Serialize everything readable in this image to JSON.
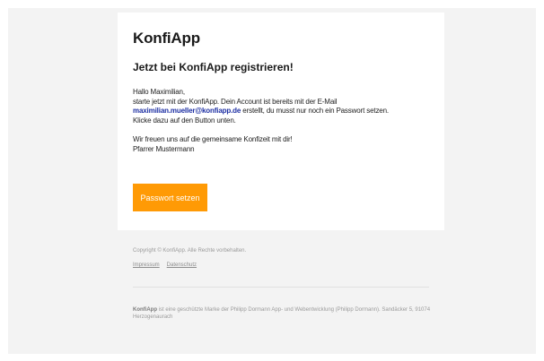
{
  "email": {
    "brand": "KonfiApp",
    "heading": "Jetzt bei KonfiApp registrieren!",
    "greeting": "Hallo Maximilian,",
    "line1": "starte jetzt mit der KonfiApp. Dein Account ist bereits mit der E-Mail",
    "email_address": "maximilian.mueller@konfiapp.de",
    "line2_rest": " erstellt, du musst nur noch ein Passwort setzen.",
    "line3": "Klicke dazu auf den Button unten.",
    "closing": "Wir freuen uns auf die gemeinsame Konfizeit mit dir!",
    "signature": "Pfarrer Mustermann",
    "cta_label": "Passwort setzen"
  },
  "footer": {
    "copyright": "Copyright © KonfiApp. Alle Rechte vorbehalten.",
    "links": [
      "Impressum",
      "Datenschutz"
    ],
    "trademark_brand": "KonfiApp",
    "trademark_text": " ist eine geschützte Marke der Philipp Dormann App- und Webentwicklung (Philipp Dormann). Sandäcker 5, 91074 Herzogenaurach"
  },
  "colors": {
    "accent": "#ff9a05",
    "link": "#1d2fa3",
    "background": "#f3f3f3"
  }
}
